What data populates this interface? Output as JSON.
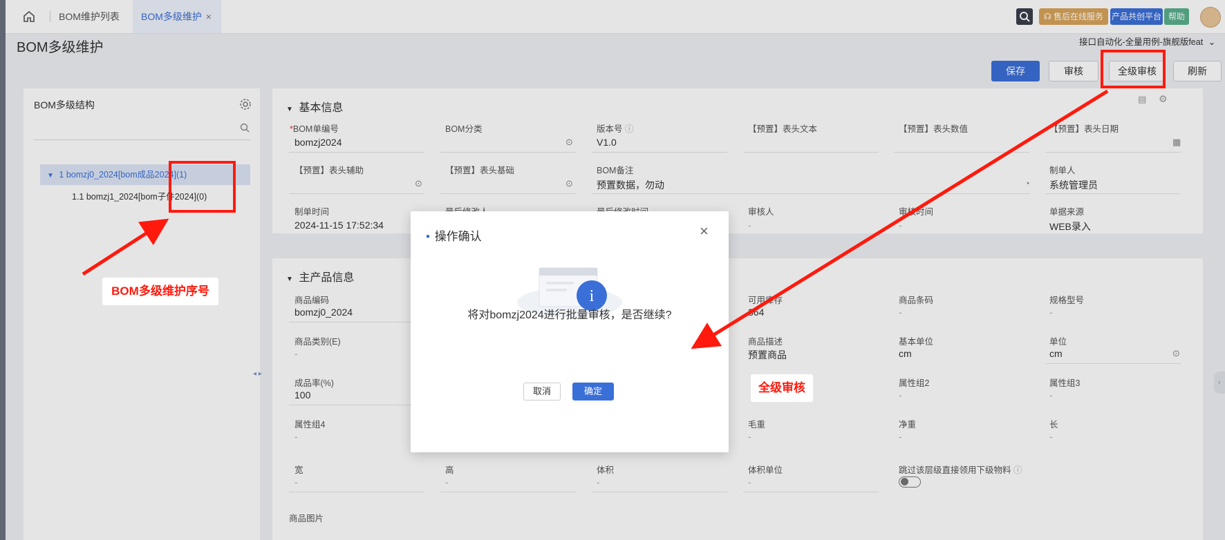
{
  "tabs": {
    "list_tab": "BOM维护列表",
    "active_tab": "BOM多级维护",
    "close": "×"
  },
  "topbar": {
    "support": "售后在线服务",
    "platform": "产品共创平台",
    "help": "帮助"
  },
  "page": {
    "title": "BOM多级维护",
    "tenant": "接口自动化-全量用例-旗舰版feat"
  },
  "toolbar": {
    "save": "保存",
    "audit": "审核",
    "full_audit": "全级审核",
    "refresh": "刷新"
  },
  "tree": {
    "title": "BOM多级结构",
    "root": "1 bomzj0_2024[bom成品2024](1)",
    "child": "1.1 bomzj1_2024[bom子件2024](0)"
  },
  "basic": {
    "title": "基本信息",
    "bom_no_req": "*",
    "bom_no_label": "BOM单编号",
    "bom_no": "bomzj2024",
    "bom_cat_label": "BOM分类",
    "version_label": "版本号",
    "version": "V1.0",
    "h_text_label": "【预置】表头文本",
    "h_num_label": "【预置】表头数值",
    "h_date_label": "【预置】表头日期",
    "h_aux_label": "【预置】表头辅助",
    "h_base_label": "【预置】表头基础",
    "remark_label": "BOM备注",
    "remark": "预置数据，勿动",
    "creator_label": "制单人",
    "creator": "系统管理员",
    "ctime_label": "制单时间",
    "ctime": "2024-11-15 17:52:34",
    "modifier_label": "最后修改人",
    "mtime_label": "最后修改时间",
    "auditor_label": "审核人",
    "auditor": "-",
    "atime_label": "审核时间",
    "atime": "-",
    "source_label": "单据来源",
    "source": "WEB录入"
  },
  "main_product": {
    "title": "主产品信息",
    "code_label": "商品编码",
    "code": "bomzj0_2024",
    "stock_label": "可用库存",
    "stock": "364",
    "barcode_label": "商品条码",
    "barcode": "-",
    "spec_label": "规格型号",
    "spec": "-",
    "cat_label": "商品类别(E)",
    "cat": "-",
    "desc_label": "商品描述",
    "desc": "预置商品",
    "base_unit_label": "基本单位",
    "base_unit": "cm",
    "unit_label": "单位",
    "unit": "cm",
    "yield_label": "成品率(%)",
    "yield": "100",
    "attr2_label": "属性组2",
    "attr2": "-",
    "attr3_label": "属性组3",
    "attr3": "-",
    "attr4_label": "属性组4",
    "attr4": "-",
    "gross_label": "毛重",
    "gross": "-",
    "net_label": "净重",
    "net": "-",
    "length_label": "长",
    "length": "-",
    "width_label": "宽",
    "width": "-",
    "height_label": "高",
    "height": "-",
    "volume_label": "体积",
    "volume": "-",
    "vol_unit_label": "体积单位",
    "vol_unit": "-",
    "skip_label": "跳过该层级直接领用下级物料",
    "image_label": "商品图片"
  },
  "dialog": {
    "title": "操作确认",
    "close": "×",
    "message": "将对bomzj2024进行批量审核，是否继续?",
    "cancel": "取消",
    "ok": "确定"
  },
  "annotations": {
    "tree_label": "BOM多级维护序号",
    "audit_label": "全级审核",
    "color": "#ff1a0d"
  }
}
